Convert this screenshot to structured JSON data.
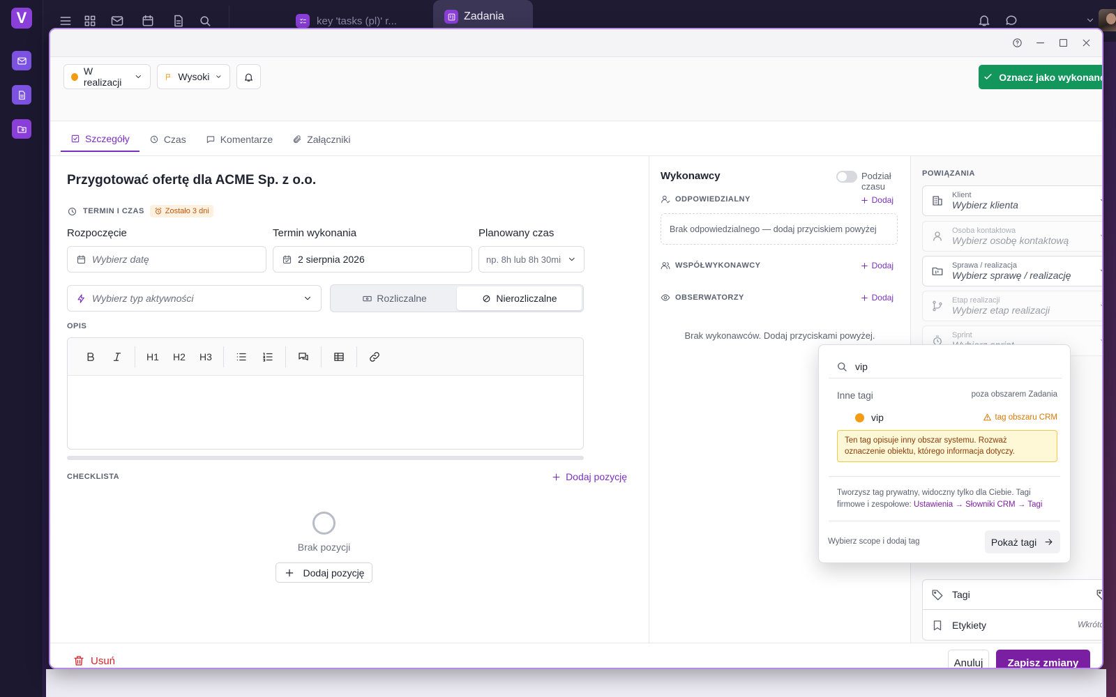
{
  "app": {
    "logo_letter": "V"
  },
  "topbar": {
    "tabs": [
      {
        "label": "key 'tasks (pl)' r..."
      },
      {
        "label": "Zadania"
      }
    ]
  },
  "modal": {
    "toolbar": {
      "status_label": "W realizacji",
      "priority_label": "Wysoki",
      "done_label": "Oznacz jako wykonane",
      "more_label": "···"
    },
    "tabs": [
      {
        "label": "Szczegóły"
      },
      {
        "label": "Czas"
      },
      {
        "label": "Komentarze"
      },
      {
        "label": "Załączniki"
      }
    ],
    "details": {
      "title": "Przygotować ofertę dla ACME Sp. z o.o.",
      "time_section": "TERMIN I CZAS",
      "time_badge": "Zostało 3 dni",
      "start_label": "Rozpoczęcie",
      "start_placeholder": "Wybierz datę",
      "due_label": "Termin wykonania",
      "due_value": "2 sierpnia 2026",
      "planned_label": "Planowany czas",
      "planned_placeholder": "np. 8h lub 8h 30min",
      "activity_placeholder": "Wybierz typ aktywności",
      "billable_label": "Rozliczalne",
      "nonbillable_label": "Nierozliczalne",
      "desc_section": "OPIS",
      "editor": {
        "h1": "H1",
        "h2": "H2",
        "h3": "H3"
      },
      "checklist_section": "CHECKLISTA",
      "add_item_label": "Dodaj pozycję",
      "empty_label": "Brak pozycji",
      "add_item_button": "Dodaj pozycję"
    },
    "assignees": {
      "title": "Wykonawcy",
      "split_time_label": "Podział czasu",
      "responsible_label": "ODPOWIEDZIALNY",
      "responsible_empty": "Brak odpowiedzialnego — dodaj przyciskiem powyżej",
      "coworkers_label": "WSPÓŁWYKONAWCY",
      "observers_label": "OBSERWATORZY",
      "add_label": "Dodaj",
      "empty_text": "Brak wykonawców. Dodaj przyciskami powyżej."
    },
    "relations": {
      "title": "POWIĄZANIA",
      "client": {
        "label": "Klient",
        "placeholder": "Wybierz klienta"
      },
      "contact": {
        "label": "Osoba kontaktowa",
        "placeholder": "Wybierz osobę kontaktową"
      },
      "case": {
        "label": "Sprawa / realizacja",
        "placeholder": "Wybierz sprawę / realizację"
      },
      "stage": {
        "label": "Etap realizacji",
        "placeholder": "Wybierz etap realizacji"
      },
      "sprint": {
        "label": "Sprint",
        "placeholder": "Wybierz sprint"
      },
      "tags_label": "Tagi",
      "labels_label": "Etykiety",
      "labels_soon": "Wkrótce"
    },
    "footer": {
      "delete_label": "Usuń",
      "cancel_label": "Anuluj",
      "save_label": "Zapisz zmiany"
    }
  },
  "tag_popover": {
    "search_value": "vip",
    "group_label": "Inne tagi",
    "group_scope": "poza obszarem Zadania",
    "item": {
      "name": "vip",
      "color": "#f39b12",
      "warning": "tag obszaru CRM"
    },
    "warning_text": "Ten tag opisuje inny obszar systemu. Rozważ oznaczenie obiektu, którego informacja dotyczy.",
    "info_text": "Tworzysz tag prywatny, widoczny tylko dla Ciebie. Tagi firmowe i zespołowe: ",
    "info_link": "Ustawienia → Słowniki CRM → Tagi",
    "footer_hint": "Wybierz scope i dodaj tag",
    "show_button": "Pokaż tagi"
  },
  "colors": {
    "accent": "#7a1fa2",
    "success": "#12965c",
    "danger": "#d8232a",
    "warning": "#f39b12"
  }
}
